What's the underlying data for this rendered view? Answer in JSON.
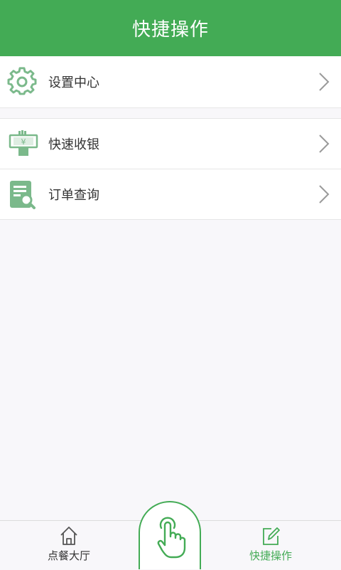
{
  "header": {
    "title": "快捷操作"
  },
  "menu": {
    "items": [
      {
        "label": "设置中心"
      },
      {
        "label": "快速收银"
      },
      {
        "label": "订单查询"
      }
    ]
  },
  "tabbar": {
    "tabs": [
      {
        "label": "点餐大厅"
      },
      {
        "label": "快捷操作"
      }
    ]
  },
  "colors": {
    "accent": "#43ab55",
    "icon_green": "#7bb98b",
    "text": "#333333",
    "background": "#f8f7fa"
  }
}
